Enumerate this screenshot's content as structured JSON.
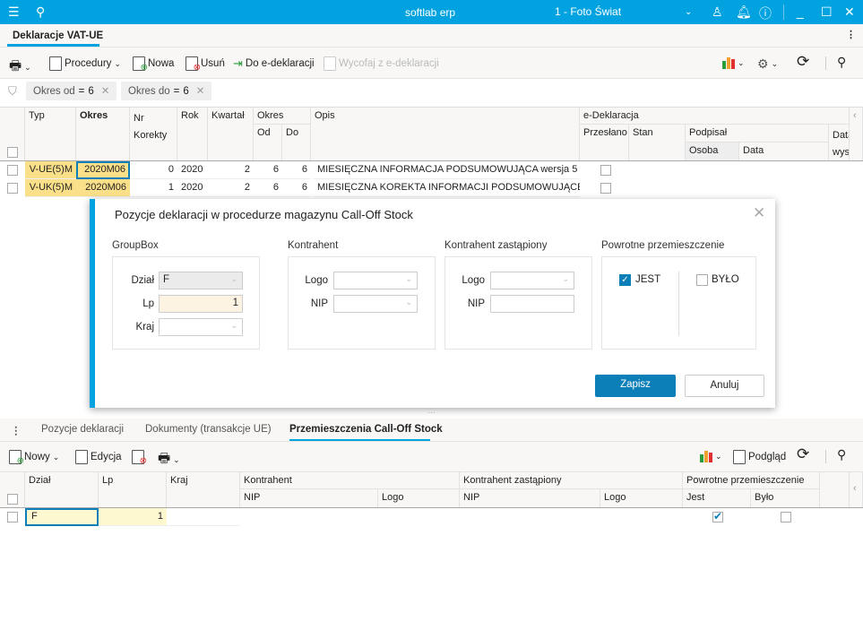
{
  "titlebar": {
    "app_title": "softlab erp",
    "company": "1 - Foto Świat",
    "icons": [
      "menu-icon",
      "search-icon",
      "chevron-down-icon",
      "user-icon",
      "bell-icon",
      "help-icon",
      "minimize-icon",
      "maximize-icon",
      "close-icon"
    ]
  },
  "main_tab": {
    "label": "Deklaracje VAT-UE"
  },
  "toolbar": {
    "procedury": "Procedury",
    "nowa": "Nowa",
    "usun": "Usuń",
    "do_edeklaracji": "Do e-deklaracji",
    "wycofaj": "Wycofaj z e-deklaracji"
  },
  "filters": [
    {
      "label": "Okres od",
      "op": "=",
      "value": "6"
    },
    {
      "label": "Okres do",
      "op": "=",
      "value": "6"
    }
  ],
  "grid": {
    "headers": {
      "typ": "Typ",
      "okres": "Okres",
      "nr": "Nr",
      "korekty": "Korekty",
      "rok": "Rok",
      "kwartal": "Kwartał",
      "okres_group": "Okres",
      "od": "Od",
      "do": "Do",
      "opis": "Opis",
      "edekl": "e-Deklaracja",
      "przeslano": "Przesłano",
      "stan": "Stan",
      "podpisal": "Podpisał",
      "osoba": "Osoba",
      "data": "Data",
      "data_wys1": "Data",
      "data_wys2": "wys"
    },
    "rows": [
      {
        "typ": "V-UE(5)M",
        "okres": "2020M06",
        "nr": "0",
        "rok": "2020",
        "kwartal": "2",
        "od": "6",
        "do": "6",
        "opis": "MIESIĘCZNA INFORMACJA PODSUMOWUJĄCA wersja 5",
        "przeslano": false
      },
      {
        "typ": "V-UK(5)M",
        "okres": "2020M06",
        "nr": "1",
        "rok": "2020",
        "kwartal": "2",
        "od": "6",
        "do": "6",
        "opis": "MIESIĘCZNA KOREKTA INFORMACJI PODSUMOWUJĄCEJ",
        "przeslano": false
      }
    ]
  },
  "dialog": {
    "title": "Pozycje deklaracji w procedurze magazynu Call-Off Stock",
    "groupbox": {
      "title": "GroupBox",
      "dzial_label": "Dział",
      "dzial_value": "F",
      "lp_label": "Lp",
      "lp_value": "1",
      "kraj_label": "Kraj",
      "kraj_value": ""
    },
    "kontrahent": {
      "title": "Kontrahent",
      "logo_label": "Logo",
      "nip_label": "NIP"
    },
    "kontrahent_zast": {
      "title": "Kontrahent zastąpiony",
      "logo_label": "Logo",
      "nip_label": "NIP"
    },
    "powrotne": {
      "title": "Powrotne przemieszczenie",
      "jest_label": "JEST",
      "jest_checked": true,
      "bylo_label": "BYŁO",
      "bylo_checked": false
    },
    "save": "Zapisz",
    "cancel": "Anuluj"
  },
  "bottom_tabs": [
    {
      "label": "Pozycje deklaracji"
    },
    {
      "label": "Dokumenty (transakcje UE)"
    },
    {
      "label": "Przemieszczenia Call-Off Stock",
      "active": true
    }
  ],
  "bottom_toolbar": {
    "nowy": "Nowy",
    "edycja": "Edycja",
    "podglad": "Podgląd"
  },
  "bottom_grid": {
    "headers": {
      "dzial": "Dział",
      "lp": "Lp",
      "kraj": "Kraj",
      "kontrahent": "Kontrahent",
      "nip": "NIP",
      "logo": "Logo",
      "kontrahent_zast": "Kontrahent zastąpiony",
      "nip2": "NIP",
      "logo2": "Logo",
      "powrotne": "Powrotne przemieszczenie",
      "jest": "Jest",
      "bylo": "Było"
    },
    "rows": [
      {
        "dzial": "F",
        "lp": "1",
        "kraj": "",
        "jest": true,
        "bylo": false
      }
    ]
  },
  "colors": {
    "accent": "#00a3e0",
    "highlight": "#fbe08a",
    "button": "#0d7fb8"
  }
}
